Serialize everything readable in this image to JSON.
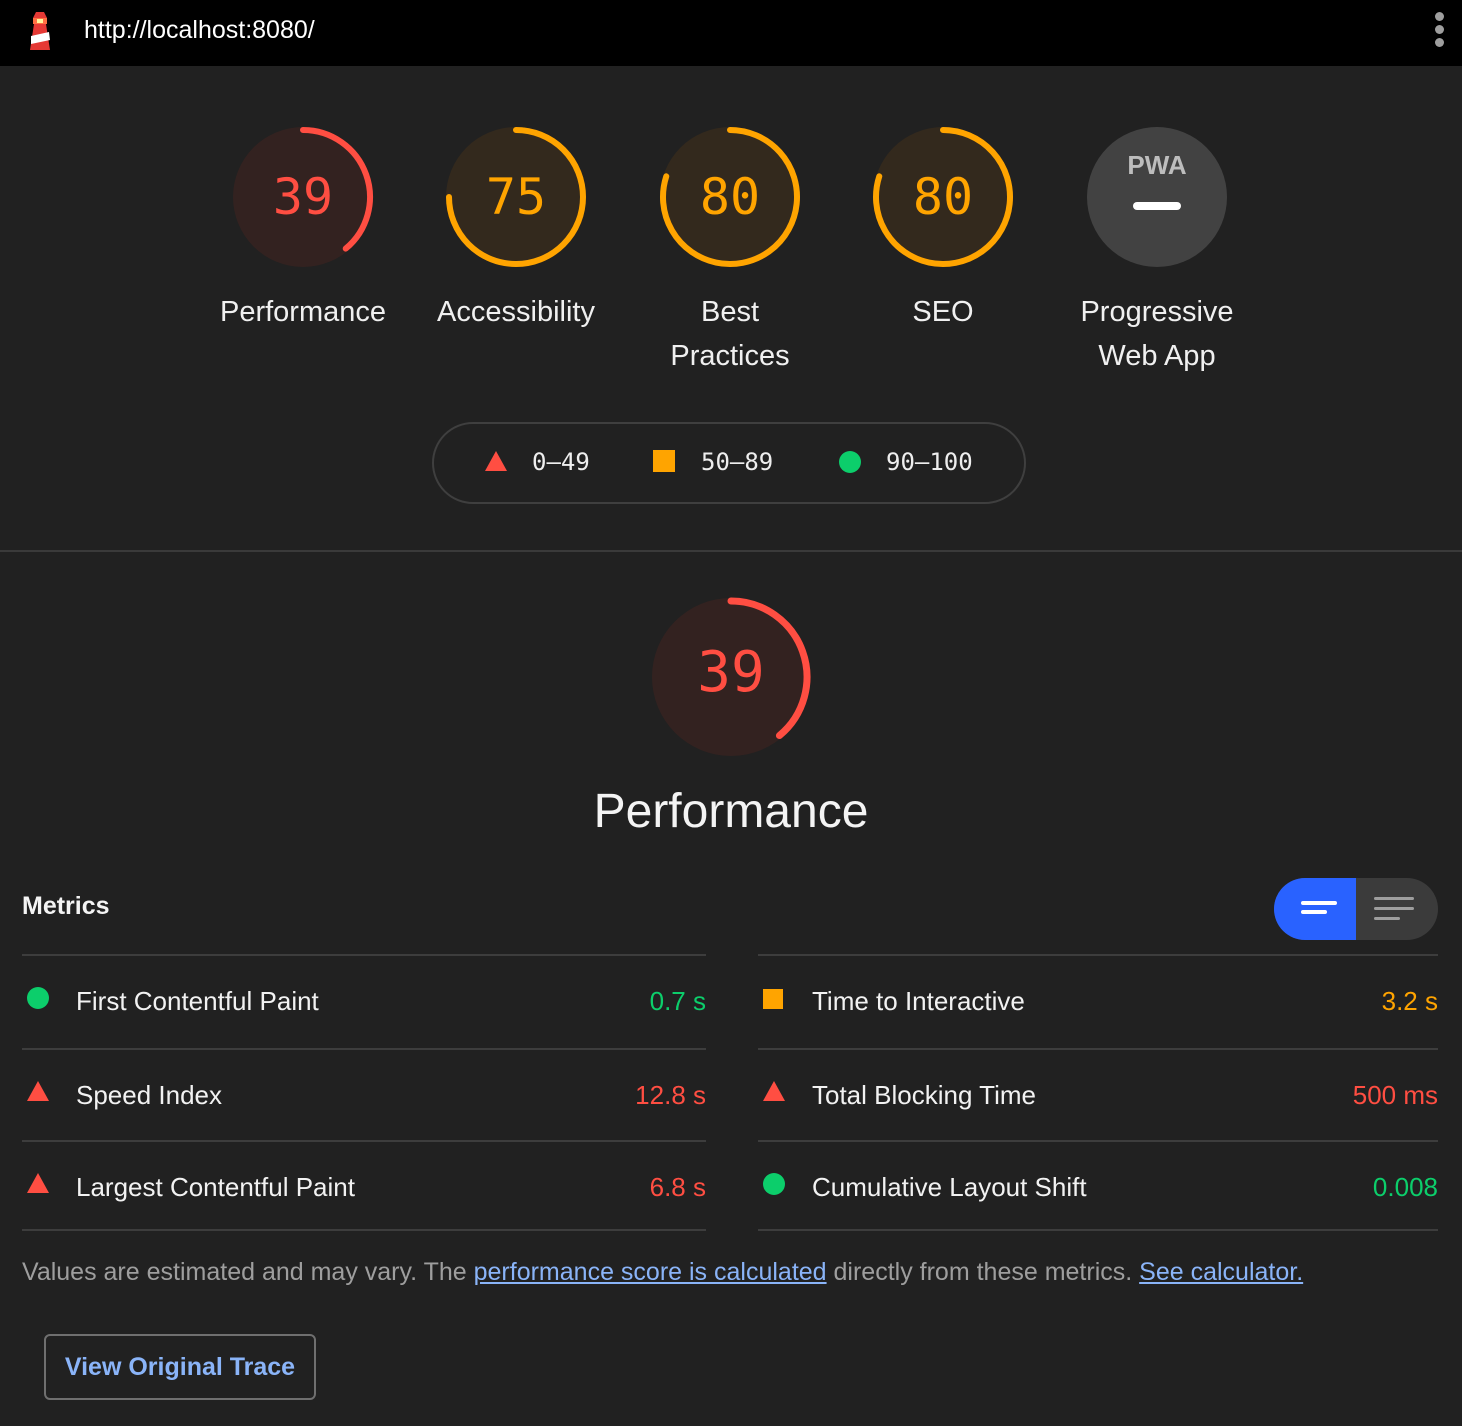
{
  "browser": {
    "url": "http://localhost:8080/"
  },
  "categories": [
    {
      "label": "Performance",
      "score": "39",
      "value": 0.39,
      "rating": "fail"
    },
    {
      "label": "Accessibility",
      "score": "75",
      "value": 0.75,
      "rating": "average"
    },
    {
      "label": "Best\nPractices",
      "score": "80",
      "value": 0.8,
      "rating": "average"
    },
    {
      "label": "SEO",
      "score": "80",
      "value": 0.8,
      "rating": "average"
    },
    {
      "label": "Progressive\nWeb App",
      "badge": "PWA",
      "rating": "na"
    }
  ],
  "legend": [
    {
      "range": "0–49",
      "shape": "triangle"
    },
    {
      "range": "50–89",
      "shape": "square"
    },
    {
      "range": "90–100",
      "shape": "circle"
    }
  ],
  "section": {
    "title": "Performance",
    "score": "39",
    "value": 0.39
  },
  "metrics": {
    "title": "Metrics",
    "left": [
      {
        "name": "First Contentful Paint",
        "value": "0.7 s",
        "rating": "pass"
      },
      {
        "name": "Speed Index",
        "value": "12.8 s",
        "rating": "fail"
      },
      {
        "name": "Largest Contentful Paint",
        "value": "6.8 s",
        "rating": "fail"
      }
    ],
    "right": [
      {
        "name": "Time to Interactive",
        "value": "3.2 s",
        "rating": "average"
      },
      {
        "name": "Total Blocking Time",
        "value": "500 ms",
        "rating": "fail"
      },
      {
        "name": "Cumulative Layout Shift",
        "value": "0.008",
        "rating": "pass"
      }
    ]
  },
  "note": {
    "before": "Values are estimated and may vary. The ",
    "link1": "performance score is calculated",
    "middle": " directly from these metrics. ",
    "link2": "See calculator."
  },
  "trace_button": "View Original Trace",
  "colors": {
    "fail": "#ff4e42",
    "average": "#ffa400",
    "pass": "#0cce6b",
    "accent": "#2962ff",
    "link": "#8ab4f8"
  },
  "icons": {
    "logo": "lighthouse-icon",
    "menu": "kebab-menu-icon",
    "view_compact": "compact-lines-icon",
    "view_expanded": "expanded-lines-icon"
  }
}
